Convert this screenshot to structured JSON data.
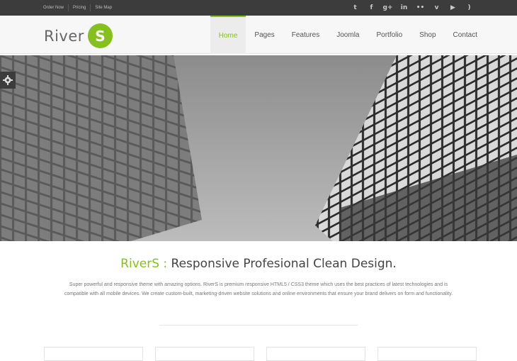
{
  "topbar": {
    "links": [
      "Order Now",
      "Pricing",
      "Site Map"
    ],
    "social": [
      {
        "icon": "twitter-icon",
        "glyph": "t"
      },
      {
        "icon": "facebook-icon",
        "glyph": "f"
      },
      {
        "icon": "googleplus-icon",
        "glyph": "g+"
      },
      {
        "icon": "linkedin-icon",
        "glyph": "in"
      },
      {
        "icon": "flickr-icon",
        "glyph": "••"
      },
      {
        "icon": "vimeo-icon",
        "glyph": "v"
      },
      {
        "icon": "youtube-icon",
        "glyph": "▶"
      },
      {
        "icon": "rss-icon",
        "glyph": ")"
      }
    ]
  },
  "logo": {
    "text": "River",
    "badge": "S"
  },
  "nav": {
    "items": [
      "Home",
      "Pages",
      "Features",
      "Joomla",
      "Portfolio",
      "Shop",
      "Contact"
    ],
    "active": "Home"
  },
  "settings": {
    "icon": "gear-icon"
  },
  "intro": {
    "brand": "RiverS :",
    "headline": " Responsive Profesional Clean Design.",
    "description": "Super powerful and responsive theme with amazing options. RiverS is premium responsive HTML5 / CSS3 theme which uses the best practices of latest technologies and is compatible with all mobile devices. We create custom-built, marketing-driven website solutions and online environments that ensure your brand delivers on form and functionality."
  },
  "colors": {
    "accent": "#86c01f",
    "topbar": "#3c3c3c"
  }
}
